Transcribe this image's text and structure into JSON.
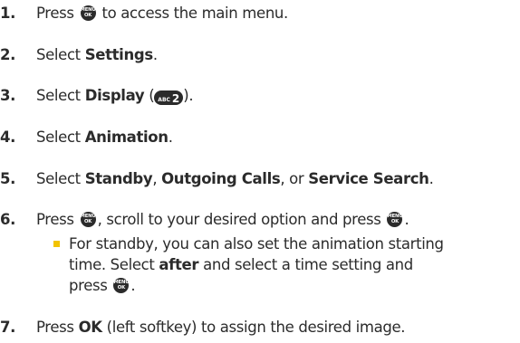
{
  "steps": [
    {
      "number": "1.",
      "pre": "Press",
      "post": "to access the main menu."
    },
    {
      "number": "2.",
      "pre": "Select",
      "bold": "Settings",
      "post": "."
    },
    {
      "number": "3.",
      "pre": "Select",
      "bold": "Display",
      "paren_open": "(",
      "paren_close": ")."
    },
    {
      "number": "4.",
      "pre": "Select",
      "bold": "Animation",
      "post": "."
    },
    {
      "number": "5.",
      "pre": "Select",
      "bold1": "Standby",
      "sep1": ",",
      "bold2": "Outgoing Calls",
      "sep2": ", or",
      "bold3": "Service Search",
      "post": "."
    },
    {
      "number": "6.",
      "pre": "Press",
      "mid": ", scroll to your desired option and press",
      "post": "."
    },
    {
      "number": "7.",
      "pre": "Press",
      "bold": "OK",
      "post": "(left softkey) to assign the desired image."
    }
  ],
  "sub_bullet": {
    "line1": "For standby, you can also set the animation starting",
    "line2": "time. Select",
    "line2_bold": "after",
    "line2_post": "and select a time setting and",
    "line3_pre": "press",
    "line3_post": "."
  },
  "keys": {
    "menu_ok_top": "MENU",
    "menu_ok_bottom": "OK",
    "abc2_small": "ABC",
    "abc2_digit": "2"
  },
  "colors": {
    "text": "#2b2b2b",
    "bullet": "#f2c300"
  },
  "icons": [
    "menu-ok-key-icon",
    "abc-2-key-icon",
    "square-bullet-icon"
  ]
}
